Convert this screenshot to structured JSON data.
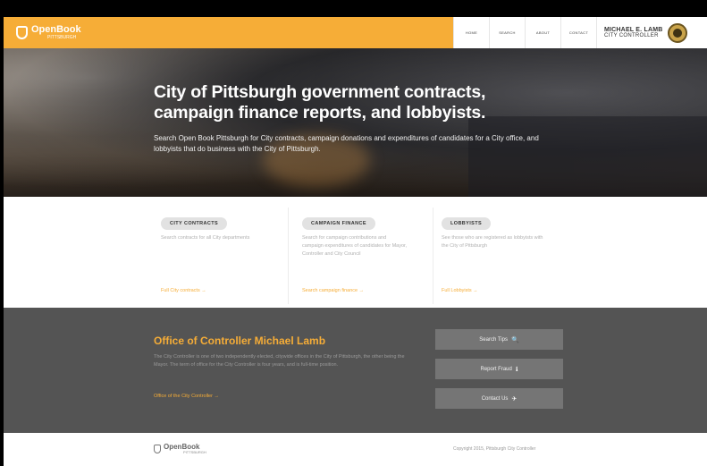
{
  "header": {
    "brand_name": "OpenBook",
    "brand_sub": "PITTSBURGH",
    "nav": [
      "HOME",
      "SEARCH",
      "ABOUT",
      "CONTACT"
    ],
    "controller_name": "MICHAEL E. LAMB",
    "controller_title": "CITY CONTROLLER"
  },
  "hero": {
    "title_line1": "City of Pittsburgh government contracts,",
    "title_line2": "campaign finance reports, and lobbyists.",
    "description": "Search Open Book Pittsburgh for City contracts, campaign donations and expenditures of candidates for a City office, and lobbyists that do business with the City of Pittsburgh."
  },
  "cards": [
    {
      "label": "CITY CONTRACTS",
      "text": "Search contracts for all City departments",
      "link": "Full City contracts →"
    },
    {
      "label": "CAMPAIGN FINANCE",
      "text": "Search for campaign contributions and campaign expenditures of candidates for Mayor, Controller and City Council",
      "link": "Search campaign finance →"
    },
    {
      "label": "LOBBYISTS",
      "text": "See those who are registered as lobbyists with the City of Pittsburgh",
      "link": "Full Lobbyists →"
    }
  ],
  "office": {
    "title": "Office of Controller Michael Lamb",
    "description": "The City Controller is one of two independently elected, citywide offices in the City of Pittsburgh, the other being the Mayor. The term of office for the City Controller is four years, and is full-time position.",
    "link": "Office of the City Controller →",
    "buttons": [
      {
        "label": "Search Tips",
        "icon": "magnifier-icon",
        "glyph": "🔍"
      },
      {
        "label": "Report Fraud",
        "icon": "info-icon",
        "glyph": "ℹ"
      },
      {
        "label": "Contact Us",
        "icon": "paper-plane-icon",
        "glyph": "✈"
      }
    ]
  },
  "footer": {
    "brand_name": "OpenBook",
    "brand_sub": "PITTSBURGH",
    "copyright": "Copyright 2015, Pittsburgh City Controller"
  },
  "colors": {
    "accent": "#f6ad37",
    "dark_section": "#545454",
    "button": "#757575"
  }
}
